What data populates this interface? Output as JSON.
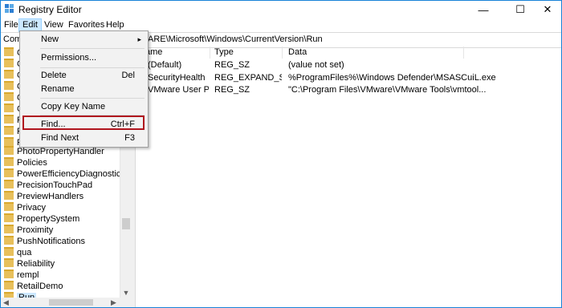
{
  "window": {
    "title": "Registry Editor",
    "minimize": "—",
    "maximize": "☐",
    "close": "✕"
  },
  "menubar": {
    "items": [
      "File",
      "Edit",
      "View",
      "Favorites",
      "Help"
    ]
  },
  "address": {
    "prefix": "Com",
    "path": "ARE\\Microsoft\\Windows\\CurrentVersion\\Run"
  },
  "tree": {
    "items": [
      "C",
      "C",
      "C",
      "C",
      "C",
      "C",
      "P",
      "P",
      "P",
      "PhotoPropertyHandler",
      "Policies",
      "PowerEfficiencyDiagnostics",
      "PrecisionTouchPad",
      "PreviewHandlers",
      "Privacy",
      "PropertySystem",
      "Proximity",
      "PushNotifications",
      "qua",
      "Reliability",
      "rempl",
      "RetailDemo",
      "Run"
    ]
  },
  "list": {
    "columns": [
      "ame",
      "Type",
      "Data"
    ],
    "rows": [
      {
        "name": "(Default)",
        "type": "REG_SZ",
        "data": "(value not set)"
      },
      {
        "name": "SecurityHealth",
        "type": "REG_EXPAND_SZ",
        "data": "%ProgramFiles%\\Windows Defender\\MSASCuiL.exe"
      },
      {
        "name": "VMware User Pr...",
        "type": "REG_SZ",
        "data": "\"C:\\Program Files\\VMware\\VMware Tools\\vmtool..."
      }
    ]
  },
  "edit_menu": {
    "new": "New",
    "permissions": "Permissions...",
    "delete": "Delete",
    "delete_shortcut": "Del",
    "rename": "Rename",
    "copy_key_name": "Copy Key Name",
    "find": "Find...",
    "find_shortcut": "Ctrl+F",
    "find_next": "Find Next",
    "find_next_shortcut": "F3"
  },
  "colors": {
    "highlight_border": "#b0151e",
    "selection": "#cce8ff",
    "window_border": "#1883d7"
  }
}
